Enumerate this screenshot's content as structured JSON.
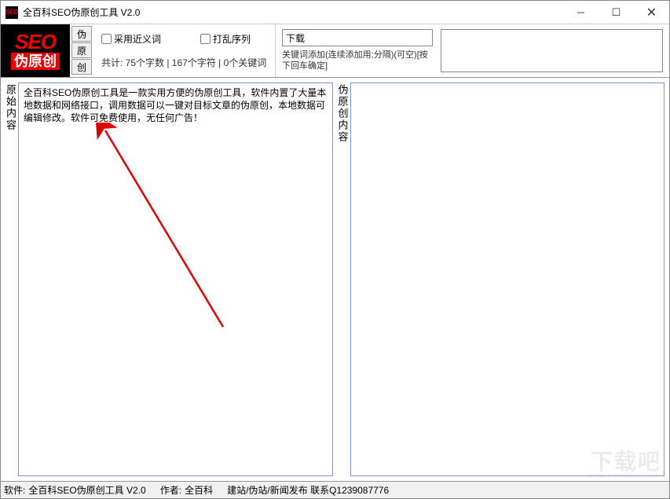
{
  "titlebar": {
    "icon_text": "SEO",
    "title": "全百科SEO伪原创工具 V2.0"
  },
  "toolbar": {
    "logo": {
      "main": "SEO",
      "sub": "伪原创"
    },
    "buttons": {
      "fake": "伪",
      "original": "原",
      "create": "创"
    },
    "checkboxes": {
      "synonym": "采用近义词",
      "shuffle": "打乱序列"
    },
    "stats": "共计: 75个字数 | 167个字符 | 0个关键词",
    "keyword_input": "下载",
    "keyword_hint": "关键词添加(连续添加用;分隔)(可空)[按下回车确定]"
  },
  "panels": {
    "left_label": "原始内容",
    "left_text": "全百科SEO伪原创工具是一款实用方便的伪原创工具，软件内置了大量本地数据和网络接口，调用数据可以一键对目标文章的伪原创，本地数据可编辑修改。软件可免费使用，无任何广告！",
    "right_label": "伪原创内容"
  },
  "statusbar": {
    "soft_label": "软件:",
    "soft_value": "全百科SEO伪原创工具 V2.0",
    "author_label": "作者:",
    "author_value": "全百科",
    "svc_label": "建站/伪站/新闻发布 联系Q1239087776"
  },
  "watermark": {
    "main": "下载吧",
    "sub": "www.xiazaiba.com"
  }
}
